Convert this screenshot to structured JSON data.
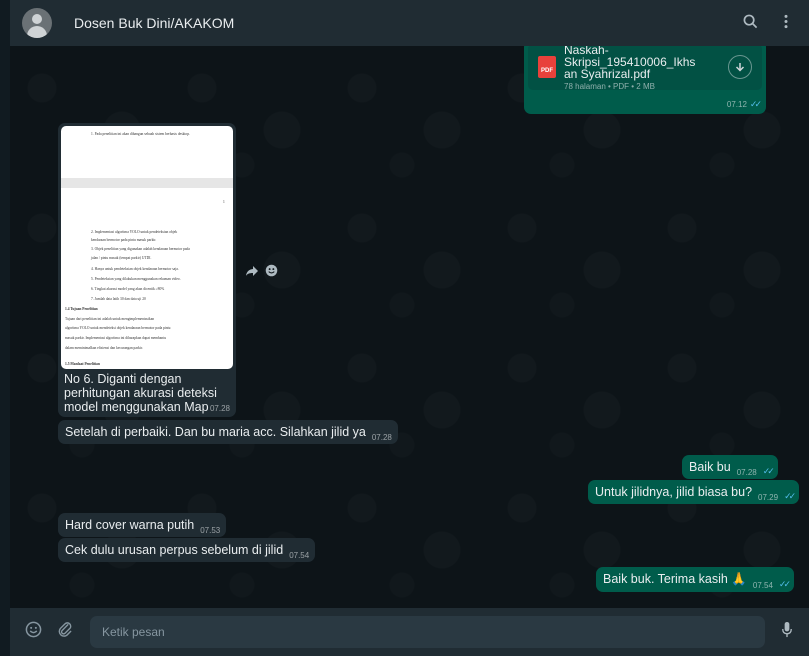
{
  "header": {
    "contact_name": "Dosen Buk Dini/AKAKOM",
    "search_icon": "search-icon",
    "menu_icon": "kebab-menu-icon"
  },
  "document_message": {
    "file_name": "Naskah-Skripsi_195410006_Ikhsan Syahrizal.pdf",
    "file_name_line1": "Naskah-Skripsi_195410006_Ikhs",
    "file_name_line2": "an Syahrizal.pdf",
    "file_type_badge": "PDF",
    "meta": "78 halaman • PDF • 2 MB",
    "time": "07.12",
    "status": "read"
  },
  "image_message": {
    "page_lines": [
      "1.   Pada penelitian ini akan dibangun sebuah sistem berbasis desktop.",
      "1",
      "2.   Implementasi  algoritma  YOLO  untuk  pendeteksian  objek",
      "      kendaraan bermotor pada pintu masuk parkir.",
      "3.   Objek penelitian yang digunakan adalah kendaraan bermotor pada",
      "      jalan / pintu masuk (tempat parkir) UTDI.",
      "4.   Hanya untuk pendeteksian objek kendaraan bermotor saja.",
      "5.   Pendeteksian yang dilakukan menggunakan rekaman video.",
      "6.   Tingkat akurasi model yang akan dicentik ≥80%",
      "7.   Jumlah data latih 30 dan data uji 20",
      "1.4 Tujuan Penelitian",
      "      Tujuan  dari  penelitian  ini  adalah  untuk  mengimplementasikan",
      "algoritma YOLO untuk mendeteksi objek kendaraan bermotor pada pintu",
      "masuk  parkir.  Implementasi  algoritma  ini  diharapkan  dapat  membantu",
      "dalam meminimalkan efisiensi dan kecurangan parkir.",
      "1.5 Manfaat Penelitian"
    ],
    "caption": "No 6. Diganti dengan perhitungan akurasi deteksi model menggunakan Map",
    "time": "07.28"
  },
  "messages": [
    {
      "id": "m1",
      "direction": "in",
      "text": "Setelah di perbaiki. Dan bu maria acc. Silahkan jilid ya",
      "time": "07.28"
    },
    {
      "id": "m2",
      "direction": "out",
      "text": "Baik bu",
      "time": "07.28",
      "status": "read"
    },
    {
      "id": "m3",
      "direction": "out",
      "text": "Untuk jilidnya, jilid biasa bu?",
      "time": "07.29",
      "status": "read"
    },
    {
      "id": "m4",
      "direction": "in",
      "text": "Hard cover warna putih",
      "time": "07.53"
    },
    {
      "id": "m5",
      "direction": "in",
      "text": "Cek dulu urusan perpus sebelum di jilid",
      "time": "07.54"
    },
    {
      "id": "m6",
      "direction": "out",
      "text": "Baik buk. Terima kasih 🙏",
      "time": "07.54",
      "status": "read"
    }
  ],
  "composer": {
    "placeholder": "Ketik pesan",
    "emoji_icon": "emoji-icon",
    "attach_icon": "paperclip-icon",
    "mic_icon": "microphone-icon"
  },
  "colors": {
    "incoming_bubble": "#202c33",
    "outgoing_bubble": "#005c4b",
    "read_ticks": "#53bdeb",
    "header_bg": "#202c33",
    "chat_bg": "#0d1418"
  }
}
